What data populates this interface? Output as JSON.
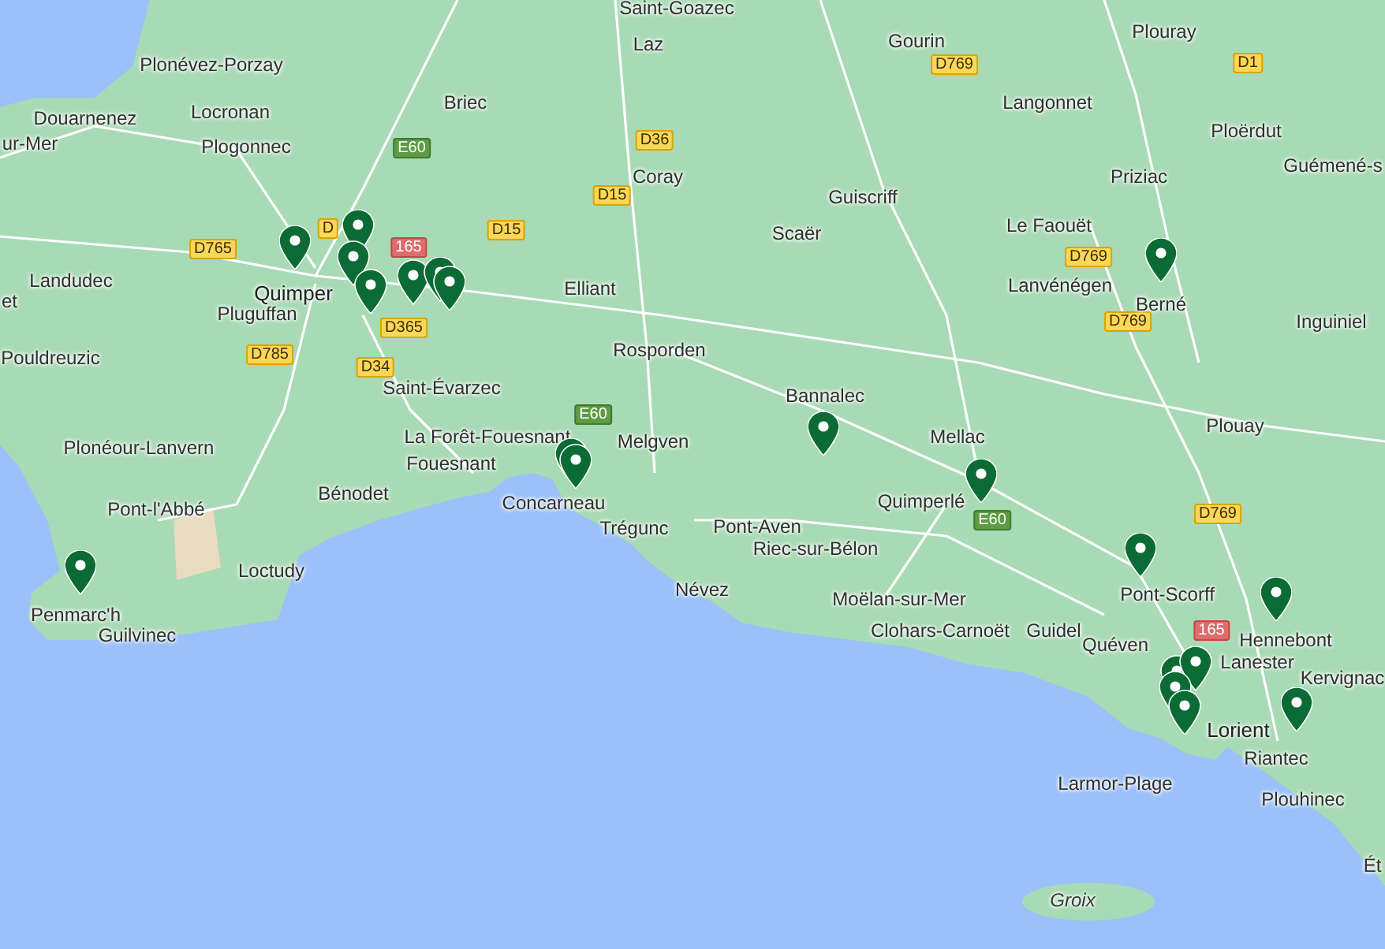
{
  "map": {
    "places": [
      {
        "name": "Saint-Goazec",
        "kind": "town"
      },
      {
        "name": "Laz",
        "kind": "town"
      },
      {
        "name": "Gourin",
        "kind": "town"
      },
      {
        "name": "Plouray",
        "kind": "town"
      },
      {
        "name": "Plonévez-Porzay",
        "kind": "town"
      },
      {
        "name": "Briec",
        "kind": "town"
      },
      {
        "name": "Langonnet",
        "kind": "town"
      },
      {
        "name": "Ploërdut",
        "kind": "town"
      },
      {
        "name": "Douarnenez",
        "kind": "town"
      },
      {
        "name": "ur-Mer",
        "kind": "town"
      },
      {
        "name": "Locronan",
        "kind": "town"
      },
      {
        "name": "Plogonnec",
        "kind": "town"
      },
      {
        "name": "Coray",
        "kind": "town"
      },
      {
        "name": "Priziac",
        "kind": "town"
      },
      {
        "name": "Guémené-s",
        "kind": "town"
      },
      {
        "name": "Guiscriff",
        "kind": "town"
      },
      {
        "name": "Scaër",
        "kind": "town"
      },
      {
        "name": "Le Faouët",
        "kind": "town"
      },
      {
        "name": "Landudec",
        "kind": "town"
      },
      {
        "name": "et",
        "kind": "town"
      },
      {
        "name": "Quimper",
        "kind": "city"
      },
      {
        "name": "Elliant",
        "kind": "town"
      },
      {
        "name": "Lanvénégen",
        "kind": "town"
      },
      {
        "name": "Berné",
        "kind": "town"
      },
      {
        "name": "Inguiniel",
        "kind": "town"
      },
      {
        "name": "Pluguffan",
        "kind": "town"
      },
      {
        "name": "Pouldreuzic",
        "kind": "town"
      },
      {
        "name": "Rosporden",
        "kind": "town"
      },
      {
        "name": "Saint-Évarzec",
        "kind": "town"
      },
      {
        "name": "Bannalec",
        "kind": "town"
      },
      {
        "name": "Plouay",
        "kind": "town"
      },
      {
        "name": "La Forêt-Fouesnant",
        "kind": "town"
      },
      {
        "name": "Plonéour-Lanvern",
        "kind": "town"
      },
      {
        "name": "Melgven",
        "kind": "town"
      },
      {
        "name": "Mellac",
        "kind": "town"
      },
      {
        "name": "Fouesnant",
        "kind": "town"
      },
      {
        "name": "Pont-l'Abbé",
        "kind": "town"
      },
      {
        "name": "Bénodet",
        "kind": "town"
      },
      {
        "name": "Concarneau",
        "kind": "town"
      },
      {
        "name": "Quimperlé",
        "kind": "town"
      },
      {
        "name": "Trégunc",
        "kind": "town"
      },
      {
        "name": "Pont-Aven",
        "kind": "town"
      },
      {
        "name": "Riec-sur-Bélon",
        "kind": "town"
      },
      {
        "name": "Pont-Scorff",
        "kind": "town"
      },
      {
        "name": "Loctudy",
        "kind": "town"
      },
      {
        "name": "Penmarc'h",
        "kind": "town"
      },
      {
        "name": "Névez",
        "kind": "town"
      },
      {
        "name": "Moëlan-sur-Mer",
        "kind": "town"
      },
      {
        "name": "Guilvinec",
        "kind": "town"
      },
      {
        "name": "Hennebont",
        "kind": "town"
      },
      {
        "name": "Clohars-Carnoët",
        "kind": "town"
      },
      {
        "name": "Guidel",
        "kind": "town"
      },
      {
        "name": "Quéven",
        "kind": "town"
      },
      {
        "name": "Lanester",
        "kind": "town"
      },
      {
        "name": "Kervignac",
        "kind": "town"
      },
      {
        "name": "Lorient",
        "kind": "city"
      },
      {
        "name": "Riantec",
        "kind": "town"
      },
      {
        "name": "Larmor-Plage",
        "kind": "town"
      },
      {
        "name": "Plouhinec",
        "kind": "town"
      },
      {
        "name": "Groix",
        "kind": "island"
      },
      {
        "name": "Ét",
        "kind": "town"
      }
    ],
    "roads": [
      {
        "ref": "E60",
        "kind": "european"
      },
      {
        "ref": "D765",
        "kind": "departmental"
      },
      {
        "ref": "D",
        "kind": "departmental"
      },
      {
        "ref": "165",
        "kind": "national"
      },
      {
        "ref": "D365",
        "kind": "departmental"
      },
      {
        "ref": "D785",
        "kind": "departmental"
      },
      {
        "ref": "D34",
        "kind": "departmental"
      },
      {
        "ref": "D36",
        "kind": "departmental"
      },
      {
        "ref": "D15",
        "kind": "departmental"
      },
      {
        "ref": "D15",
        "kind": "departmental"
      },
      {
        "ref": "E60",
        "kind": "european"
      },
      {
        "ref": "D769",
        "kind": "departmental"
      },
      {
        "ref": "D1",
        "kind": "departmental"
      },
      {
        "ref": "D769",
        "kind": "departmental"
      },
      {
        "ref": "D769",
        "kind": "departmental"
      },
      {
        "ref": "D769",
        "kind": "departmental"
      },
      {
        "ref": "E60",
        "kind": "european"
      },
      {
        "ref": "165",
        "kind": "national"
      }
    ]
  }
}
